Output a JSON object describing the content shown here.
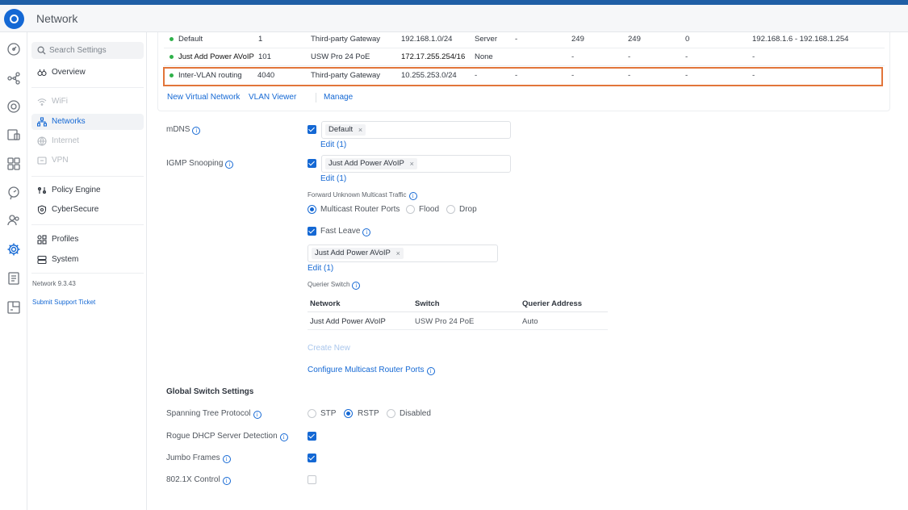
{
  "app": {
    "title": "Network"
  },
  "rail": {
    "items": [
      {
        "name": "dashboard-icon"
      },
      {
        "name": "topology-icon"
      },
      {
        "name": "devices-icon"
      },
      {
        "name": "clients-icon"
      },
      {
        "name": "ports-icon"
      },
      {
        "name": "insights-icon"
      },
      {
        "name": "users-icon"
      },
      {
        "name": "settings-icon"
      },
      {
        "name": "logs-icon"
      },
      {
        "name": "floorplan-icon"
      }
    ]
  },
  "sidebar": {
    "search_placeholder": "Search Settings",
    "overview": "Overview",
    "wifi": "WiFi",
    "networks": "Networks",
    "internet": "Internet",
    "vpn": "VPN",
    "policy_engine": "Policy Engine",
    "cybersecure": "CyberSecure",
    "profiles": "Profiles",
    "system": "System",
    "version": "Network 9.3.43",
    "support": "Submit Support Ticket"
  },
  "networks_table": {
    "rows": [
      {
        "name": "Default",
        "vlan": "1",
        "router": "Third-party Gateway",
        "subnet": "192.168.1.0/24",
        "dhcp": "Server",
        "c1": "-",
        "c2": "249",
        "c3": "249",
        "c4": "0",
        "range": "192.168.1.6 - 192.168.1.254"
      },
      {
        "name": "Just Add Power AVoIP",
        "vlan": "101",
        "router": "USW Pro 24 PoE",
        "subnet": "172.17.255.254/16",
        "dhcp": "None",
        "c1": "-",
        "c2": "-",
        "c3": "-",
        "c4": "-",
        "range": "-"
      },
      {
        "name": "Inter-VLAN routing",
        "vlan": "4040",
        "router": "Third-party Gateway",
        "subnet": "10.255.253.0/24",
        "dhcp": "-",
        "c1": "-",
        "c2": "-",
        "c3": "-",
        "c4": "-",
        "range": "-"
      }
    ],
    "new_network": "New Virtual Network",
    "vlan_viewer": "VLAN Viewer",
    "manage": "Manage"
  },
  "mdns": {
    "label": "mDNS",
    "checked": true,
    "tag": "Default",
    "tag_close": "×",
    "edit": "Edit (1)"
  },
  "igmp": {
    "label": "IGMP Snooping",
    "checked": true,
    "tag": "Just Add Power AVoIP",
    "tag_close": "×",
    "edit": "Edit (1)",
    "forward_label": "Forward Unknown Multicast Traffic",
    "opt_multicast": "Multicast Router Ports",
    "opt_flood": "Flood",
    "opt_drop": "Drop",
    "fast_leave": "Fast Leave",
    "fast_leave_tag": "Just Add Power AVoIP",
    "fast_leave_edit": "Edit (1)",
    "querier_label": "Querier Switch",
    "querier_headers": {
      "network": "Network",
      "switch": "Switch",
      "address": "Querier Address"
    },
    "querier_row": {
      "network": "Just Add Power AVoIP",
      "switch": "USW Pro 24 PoE",
      "address": "Auto"
    },
    "create_new": "Create New",
    "configure_ports": "Configure Multicast Router Ports"
  },
  "global": {
    "title": "Global Switch Settings",
    "stp_label": "Spanning Tree Protocol",
    "stp_opts": {
      "stp": "STP",
      "rstp": "RSTP",
      "disabled": "Disabled"
    },
    "stp_selected": "RSTP",
    "rogue_label": "Rogue DHCP Server Detection",
    "jumbo_label": "Jumbo Frames",
    "dot1x_label": "802.1X Control"
  },
  "colors": {
    "accent": "#1468d4",
    "highlight": "#e2753a",
    "status_green": "#2fb14a"
  }
}
